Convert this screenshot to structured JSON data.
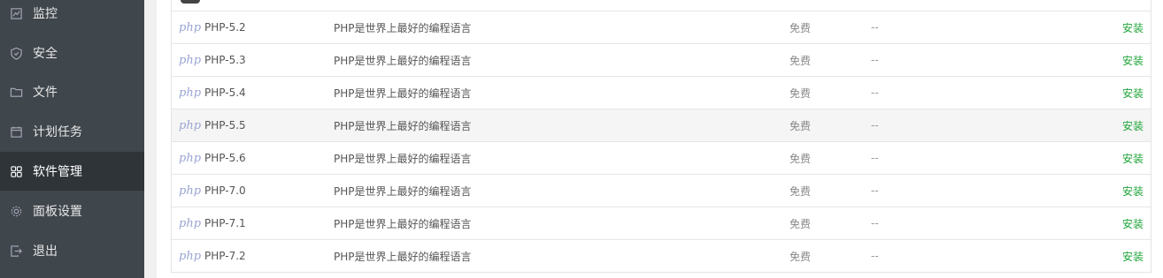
{
  "sidebar": {
    "items": [
      {
        "label": "监控",
        "icon": "monitor-icon"
      },
      {
        "label": "安全",
        "icon": "shield-icon"
      },
      {
        "label": "文件",
        "icon": "folder-icon"
      },
      {
        "label": "计划任务",
        "icon": "calendar-icon"
      },
      {
        "label": "软件管理",
        "icon": "grid-icon",
        "active": true
      },
      {
        "label": "面板设置",
        "icon": "gear-icon"
      },
      {
        "label": "退出",
        "icon": "logout-icon"
      }
    ]
  },
  "table": {
    "rows": [
      {
        "logo": "php",
        "name": "PHP-5.2",
        "desc": "PHP是世界上最好的编程语言",
        "price": "免费",
        "expire": "--",
        "action": "安装"
      },
      {
        "logo": "php",
        "name": "PHP-5.3",
        "desc": "PHP是世界上最好的编程语言",
        "price": "免费",
        "expire": "--",
        "action": "安装"
      },
      {
        "logo": "php",
        "name": "PHP-5.4",
        "desc": "PHP是世界上最好的编程语言",
        "price": "免费",
        "expire": "--",
        "action": "安装"
      },
      {
        "logo": "php",
        "name": "PHP-5.5",
        "desc": "PHP是世界上最好的编程语言",
        "price": "免费",
        "expire": "--",
        "action": "安装"
      },
      {
        "logo": "php",
        "name": "PHP-5.6",
        "desc": "PHP是世界上最好的编程语言",
        "price": "免费",
        "expire": "--",
        "action": "安装"
      },
      {
        "logo": "php",
        "name": "PHP-7.0",
        "desc": "PHP是世界上最好的编程语言",
        "price": "免费",
        "expire": "--",
        "action": "安装"
      },
      {
        "logo": "php",
        "name": "PHP-7.1",
        "desc": "PHP是世界上最好的编程语言",
        "price": "免费",
        "expire": "--",
        "action": "安装"
      },
      {
        "logo": "php",
        "name": "PHP-7.2",
        "desc": "PHP是世界上最好的编程语言",
        "price": "免费",
        "expire": "--",
        "action": "安装"
      }
    ]
  },
  "colors": {
    "sidebar_bg": "#3f464c",
    "sidebar_active_bg": "#2f3439",
    "install_link": "#20a53a",
    "php_logo": "#9aa6d4"
  }
}
